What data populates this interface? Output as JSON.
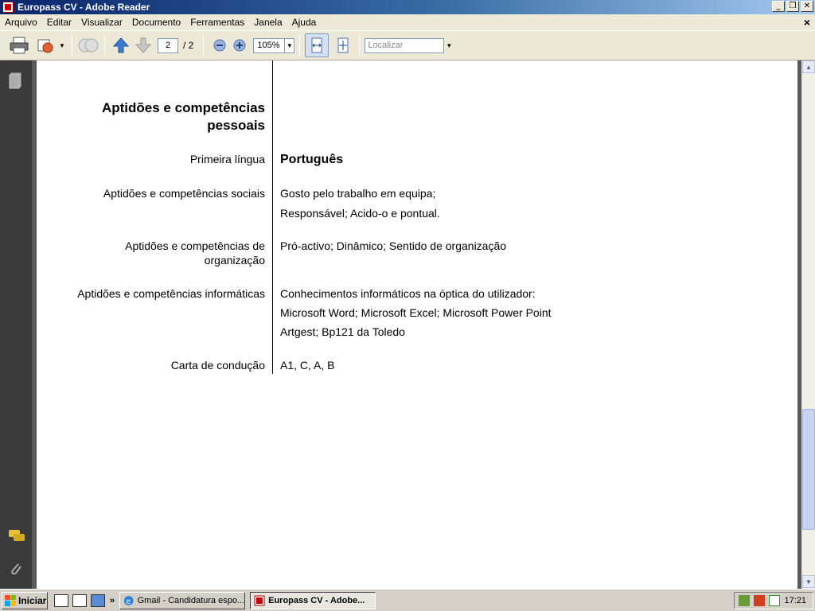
{
  "window": {
    "title": "Europass CV  - Adobe Reader",
    "min_label": "_",
    "max_label": "❐",
    "close_label": "✕"
  },
  "menu": {
    "items": [
      "Arquivo",
      "Editar",
      "Visualizar",
      "Documento",
      "Ferramentas",
      "Janela",
      "Ajuda"
    ],
    "close_label": "×"
  },
  "toolbar": {
    "current_page": "2",
    "total_pages": "/  2",
    "zoom": "105%",
    "find_placeholder": "Localizar"
  },
  "document": {
    "section_heading_line1": "Aptidões e competências",
    "section_heading_line2": "pessoais",
    "rows": [
      {
        "label": "Primeira língua",
        "values": [
          "Português"
        ]
      },
      {
        "label": "Aptidões e competências sociais",
        "values": [
          "Gosto pelo trabalho em equipa;",
          "Responsável; Acido-o e pontual."
        ]
      },
      {
        "label_line1": "Aptidões e competências de",
        "label_line2": "organização",
        "values": [
          "Pró-activo; Dinâmico; Sentido de organização"
        ]
      },
      {
        "label": "Aptidões e competências informáticas",
        "values": [
          "Conhecimentos informáticos na óptica do utilizador:",
          "Microsoft Word; Microsoft Excel; Microsoft Power Point",
          "Artgest; Bp121 da Toledo"
        ]
      },
      {
        "label": "Carta de condução",
        "values": [
          "A1, C, A, B"
        ]
      }
    ]
  },
  "taskbar": {
    "start_label": "Iniciar",
    "more": "»",
    "tasks": [
      "Gmail - Candidatura espo...",
      "Europass CV  - Adobe..."
    ],
    "clock": "17:21"
  }
}
